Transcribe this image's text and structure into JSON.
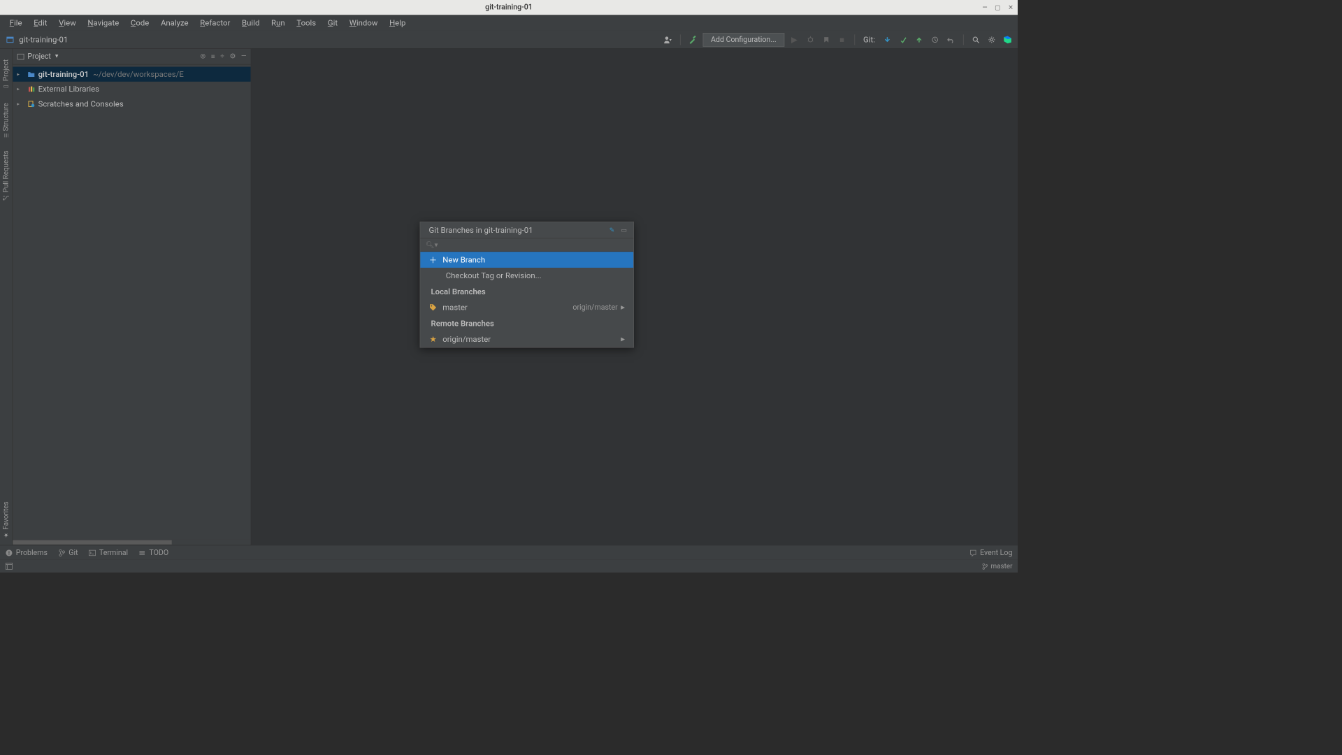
{
  "window": {
    "title": "git-training-01"
  },
  "menu": {
    "items": [
      "File",
      "Edit",
      "View",
      "Navigate",
      "Code",
      "Analyze",
      "Refactor",
      "Build",
      "Run",
      "Tools",
      "Git",
      "Window",
      "Help"
    ]
  },
  "breadcrumb": {
    "project": "git-training-01"
  },
  "toolbar": {
    "add_config": "Add Configuration...",
    "git_label": "Git:"
  },
  "project_panel": {
    "title": "Project",
    "root_name": "git-training-01",
    "root_path": "~/dev/dev/workspaces/E",
    "external_libs": "External Libraries",
    "scratches": "Scratches and Consoles"
  },
  "popup": {
    "title": "Git Branches in git-training-01",
    "new_branch": "New Branch",
    "checkout_tag": "Checkout Tag or Revision...",
    "local_section": "Local Branches",
    "local_branch": "master",
    "local_tracking": "origin/master",
    "remote_section": "Remote Branches",
    "remote_branch": "origin/master"
  },
  "bottom_tools": {
    "problems": "Problems",
    "git": "Git",
    "terminal": "Terminal",
    "todo": "TODO",
    "event_log": "Event Log"
  },
  "status": {
    "branch": "master"
  }
}
